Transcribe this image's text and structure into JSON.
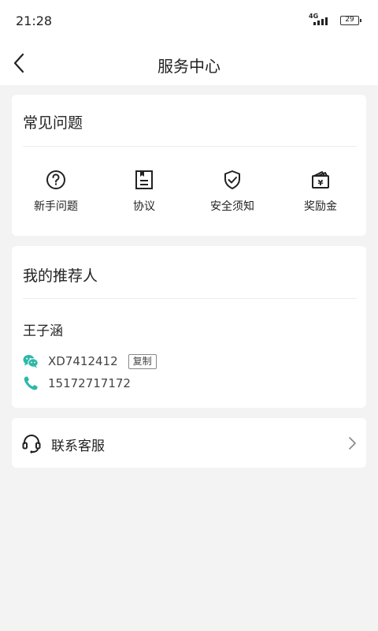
{
  "status": {
    "time": "21:28",
    "network": "4G",
    "battery": "29"
  },
  "nav": {
    "title": "服务中心"
  },
  "faq": {
    "title": "常见问题",
    "items": [
      {
        "label": "新手问题",
        "icon": "question-circle-icon"
      },
      {
        "label": "协议",
        "icon": "document-icon"
      },
      {
        "label": "安全须知",
        "icon": "shield-check-icon"
      },
      {
        "label": "奖励金",
        "icon": "wallet-yuan-icon"
      }
    ]
  },
  "referrer": {
    "title": "我的推荐人",
    "name": "王子涵",
    "wechat": "XD7412412",
    "copy_label": "复制",
    "phone": "15172717172",
    "accent": "#2cb8a8"
  },
  "contact": {
    "label": "联系客服"
  }
}
